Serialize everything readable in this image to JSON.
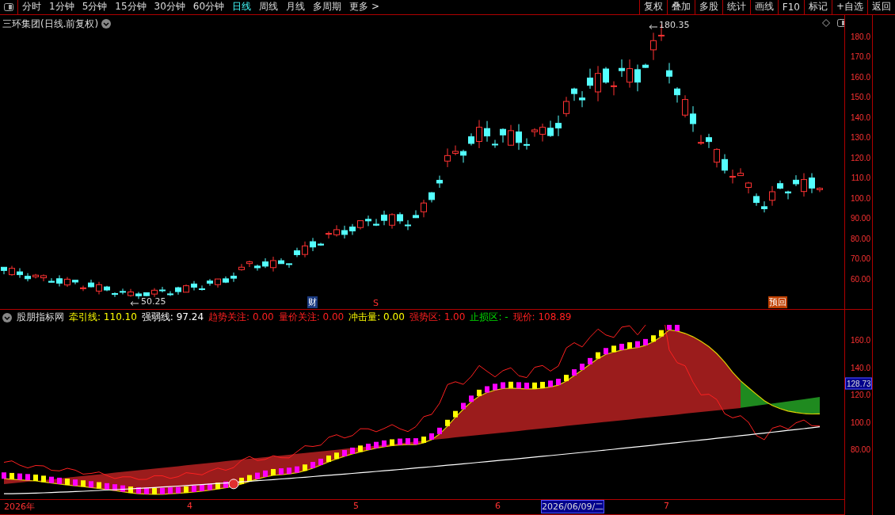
{
  "toolbar": {
    "periods": [
      {
        "label": "分时",
        "selected": false
      },
      {
        "label": "1分钟",
        "selected": false
      },
      {
        "label": "5分钟",
        "selected": false
      },
      {
        "label": "15分钟",
        "selected": false
      },
      {
        "label": "30分钟",
        "selected": false
      },
      {
        "label": "60分钟",
        "selected": false
      },
      {
        "label": "日线",
        "selected": true
      },
      {
        "label": "周线",
        "selected": false
      },
      {
        "label": "月线",
        "selected": false
      },
      {
        "label": "多周期",
        "selected": false
      },
      {
        "label": "更多 >",
        "selected": false
      }
    ],
    "actions": [
      "复权",
      "叠加",
      "多股",
      "统计",
      "画线",
      "F10",
      "标记",
      "+自选",
      "返回"
    ]
  },
  "price_chart": {
    "title": "三环集团(日线.前复权)",
    "high_label": "180.35",
    "low_label": "50.25",
    "y_labels": [
      "180.0",
      "170.0",
      "160.0",
      "150.0",
      "140.0",
      "130.0",
      "120.0",
      "110.0",
      "100.0",
      "90.00",
      "80.00",
      "70.00",
      "60.00"
    ],
    "event_markers": [
      {
        "text": "财",
        "kind": "finance"
      },
      {
        "text": "S",
        "kind": "split"
      },
      {
        "text": "预回",
        "kind": "notice"
      }
    ]
  },
  "indicator": {
    "name": "股朋指标网",
    "values": [
      {
        "label": "牵引线: 110.10",
        "color": "#ffff00"
      },
      {
        "label": "强弱线: 97.24",
        "color": "#ffffff"
      },
      {
        "label": "趋势关注: 0.00",
        "color": "#ff2020"
      },
      {
        "label": "量价关注: 0.00",
        "color": "#ff2020"
      },
      {
        "label": "冲击量: 0.00",
        "color": "#ffff00"
      },
      {
        "label": "强势区: 1.00",
        "color": "#ff2020"
      },
      {
        "label": "止损区: -",
        "color": "#00e000"
      },
      {
        "label": "现价: 108.89",
        "color": "#ff2020"
      }
    ],
    "y_labels": [
      "160.0",
      "140.0",
      "120.0",
      "100.0",
      "80.00"
    ],
    "current_badge": "128.73"
  },
  "time_axis": {
    "labels": [
      "2026年",
      "4",
      "5",
      "6",
      "7"
    ],
    "cursor_date": "2026/06/09/二"
  }
}
